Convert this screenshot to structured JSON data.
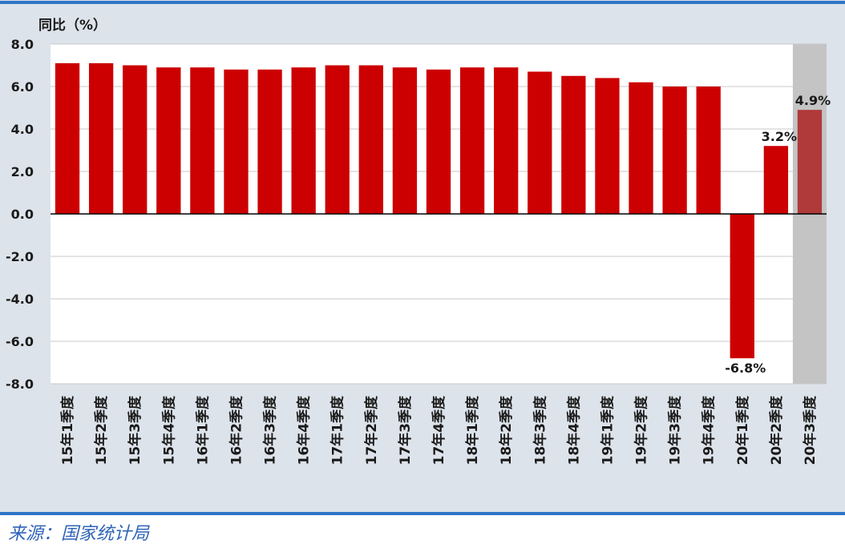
{
  "chart_data": {
    "type": "bar",
    "ylabel": "同比（%）",
    "yticks": [
      "8.0",
      "6.0",
      "4.0",
      "2.0",
      "0.0",
      "-2.0",
      "-4.0",
      "-6.0",
      "-8.0"
    ],
    "ylim": [
      -8,
      8
    ],
    "grid": true,
    "categories": [
      "15年1季度",
      "15年2季度",
      "15年3季度",
      "15年4季度",
      "16年1季度",
      "16年2季度",
      "16年3季度",
      "16年4季度",
      "17年1季度",
      "17年2季度",
      "17年3季度",
      "17年4季度",
      "18年1季度",
      "18年2季度",
      "18年3季度",
      "18年4季度",
      "19年1季度",
      "19年2季度",
      "19年3季度",
      "19年4季度",
      "20年1季度",
      "20年2季度",
      "20年3季度"
    ],
    "values": [
      7.1,
      7.1,
      7.0,
      6.9,
      6.9,
      6.8,
      6.8,
      6.9,
      7.0,
      7.0,
      6.9,
      6.8,
      6.9,
      6.9,
      6.7,
      6.5,
      6.4,
      6.2,
      6.0,
      6.0,
      -6.8,
      3.2,
      4.9
    ],
    "data_labels": [
      {
        "category_index": 20,
        "text": "-6.8%"
      },
      {
        "category_index": 21,
        "text": "3.2%"
      },
      {
        "category_index": 22,
        "text": "4.9%"
      }
    ],
    "highlight_index": 22,
    "colors": {
      "bar": "#cc0000",
      "highlight_bar": "#b03a3a",
      "highlight_band": "#c4c4c4",
      "background": "#dde3ea",
      "plot": "#ffffff",
      "grid": "#c8c8c8",
      "border": "#2e75c8"
    }
  },
  "source": "来源：国家统计局"
}
